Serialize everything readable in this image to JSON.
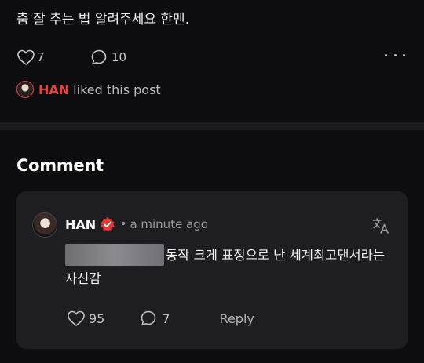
{
  "post": {
    "text": "춤 잘 추는 법 알려주세요 한멘.",
    "likes": "7",
    "comments": "10",
    "liked_by_name": "HAN",
    "liked_by_text": "liked this post"
  },
  "section": {
    "title": "Comment"
  },
  "comment": {
    "author": "HAN",
    "dot": "•",
    "time": "a minute ago",
    "body_visible": "동작 크게 표정으로 난 세계최고댄서라는 자신감",
    "likes": "95",
    "replies": "7",
    "reply_label": "Reply"
  },
  "colors": {
    "accent": "#e3453e",
    "card": "#1e1e22",
    "background": "#0d0d0f"
  },
  "icons": {
    "like": "heart-outline-icon",
    "comment": "speech-bubble-icon",
    "more": "more-dots-icon",
    "verified": "verified-badge-icon",
    "translate": "translate-icon"
  }
}
